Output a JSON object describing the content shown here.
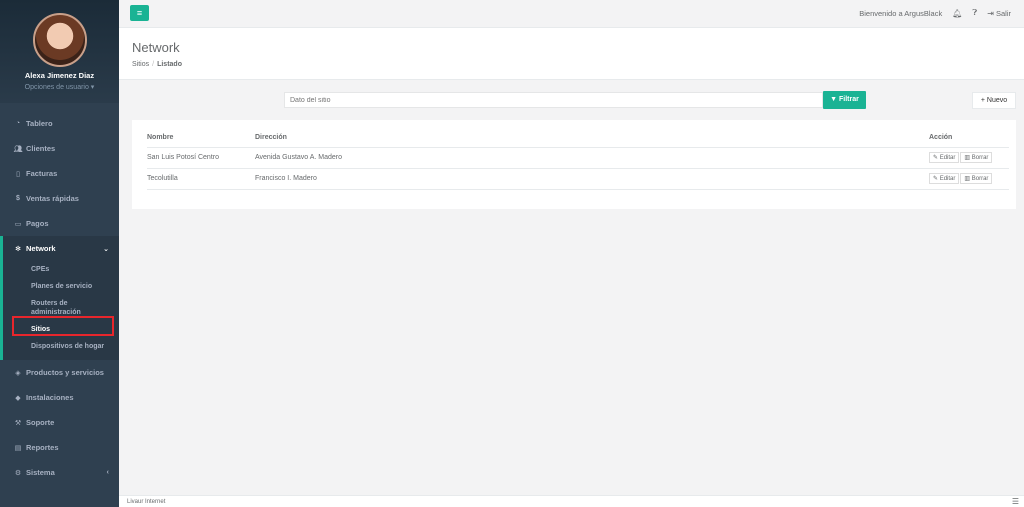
{
  "user": {
    "name": "Alexa Jimenez Diaz",
    "options": "Opciones de usuario ▾"
  },
  "nav": {
    "tablero": "Tablero",
    "clientes": "Clientes",
    "facturas": "Facturas",
    "ventas": "Ventas rápidas",
    "pagos": "Pagos",
    "network": "Network",
    "network_sub": [
      "CPEs",
      "Planes de servicio",
      "Routers de administración",
      "Sitios",
      "Dispositivos de hogar"
    ],
    "productos": "Productos y servicios",
    "instalaciones": "Instalaciones",
    "soporte": "Soporte",
    "reportes": "Reportes",
    "sistema": "Sistema"
  },
  "topbar": {
    "welcome": "Bienvenido a ArgusBlack",
    "logout": "Salir"
  },
  "page": {
    "title": "Network",
    "crumb_parent": "Sitios",
    "crumb_current": "Listado"
  },
  "filter": {
    "placeholder": "Dato del sitio",
    "button": "Filtrar",
    "new": "Nuevo"
  },
  "table": {
    "headers": {
      "name": "Nombre",
      "address": "Dirección",
      "action": "Acción"
    },
    "rows": [
      {
        "name": "San Luis Potosí Centro",
        "address": "Avenida Gustavo A. Madero"
      },
      {
        "name": "Tecolutilla",
        "address": "Francisco I. Madero"
      }
    ],
    "edit": "Editar",
    "delete": "Borrar"
  },
  "footer": {
    "text": "Livaur Internet"
  },
  "colors": {
    "accent": "#1ab394",
    "sidebar": "#2f4050",
    "highlight": "#e8262c"
  }
}
